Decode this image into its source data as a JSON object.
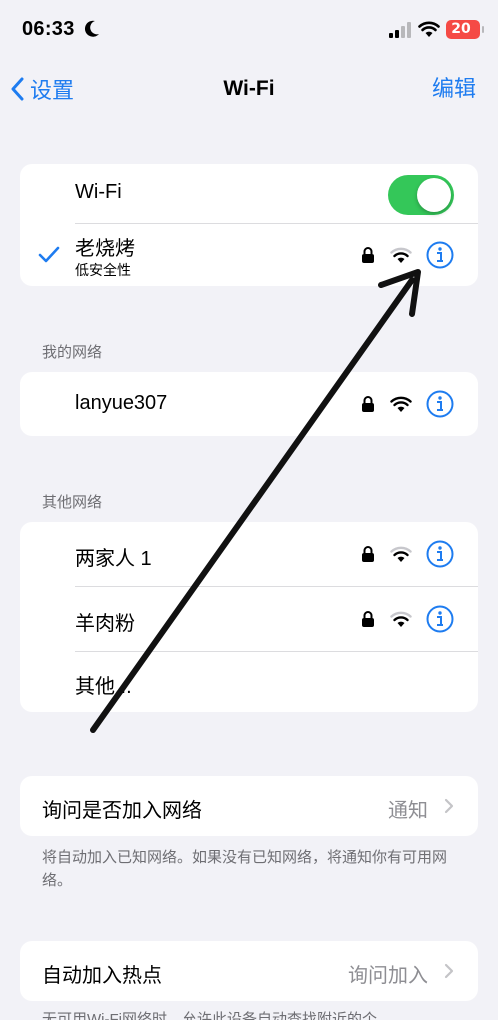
{
  "status_bar": {
    "time": "06:33",
    "battery": "20"
  },
  "nav": {
    "back_label": "设置",
    "title": "Wi-Fi",
    "edit_label": "编辑"
  },
  "wifi_card": {
    "toggle_label": "Wi-Fi",
    "toggle_on": true,
    "connected": {
      "name": "老烧烤",
      "subtitle": "低安全性"
    }
  },
  "my_networks": {
    "header": "我的网络",
    "items": [
      {
        "name": "lanyue307"
      }
    ]
  },
  "other_networks": {
    "header": "其他网络",
    "items": [
      {
        "name": "两家人 1"
      },
      {
        "name": "羊肉粉"
      }
    ],
    "other_label": "其他..."
  },
  "ask_join": {
    "label": "询问是否加入网络",
    "value": "通知",
    "footnote": "将自动加入已知网络。如果没有已知网络，将通知你有可用网络。"
  },
  "auto_join_hotspot": {
    "label": "自动加入热点",
    "value": "询问加入",
    "footnote": "无可用Wi-Fi网络时，允许此设备自动查找附近的个"
  },
  "colors": {
    "accent": "#1e7cf0",
    "toggle_on": "#34c759",
    "battery": "#f54a45"
  }
}
